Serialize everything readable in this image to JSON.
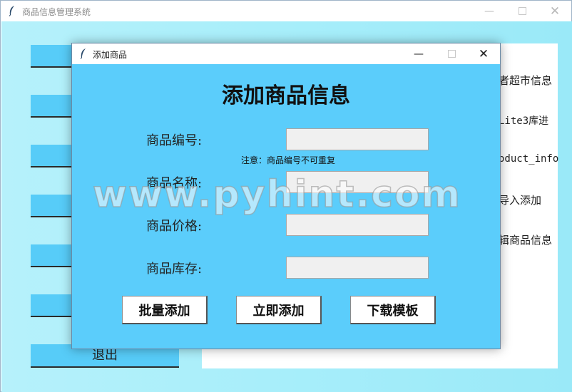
{
  "main_window": {
    "title": "商品信息管理系统",
    "exit_label": "退出",
    "info_lines": [
      "者超市信息",
      "Lite3库进",
      "oduct_info",
      "导入添加",
      "辑商品信息"
    ]
  },
  "dialog": {
    "title": "添加商品",
    "heading": "添加商品信息",
    "fields": {
      "code_label": "商品编号:",
      "name_label": "商品名称:",
      "price_label": "商品价格:",
      "stock_label": "商品库存:"
    },
    "note": "注意：商品编号不可重复",
    "buttons": {
      "batch_add": "批量添加",
      "add_now": "立即添加",
      "download_template": "下载模板"
    }
  },
  "watermark": "www.pyhint.com"
}
